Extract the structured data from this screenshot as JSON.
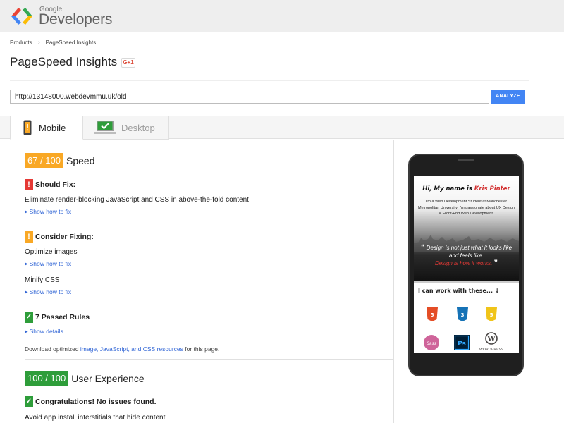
{
  "header": {
    "brand_small": "Google",
    "brand_big": "Developers"
  },
  "breadcrumb": {
    "items": [
      "Products",
      "PageSpeed Insights"
    ]
  },
  "page": {
    "title": "PageSpeed Insights",
    "gplus_label": "G+1"
  },
  "search": {
    "url_value": "http://13148000.webdevmmu.uk/old",
    "analyze_label": "ANALYZE"
  },
  "tabs": [
    {
      "label": "Mobile",
      "active": true
    },
    {
      "label": "Desktop",
      "active": false
    }
  ],
  "speed": {
    "score": "67 / 100",
    "label": "Speed",
    "should_fix_title": "Should Fix:",
    "should_fix_items": [
      {
        "text": "Eliminate render-blocking JavaScript and CSS in above-the-fold content",
        "link": "Show how to fix"
      }
    ],
    "consider_title": "Consider Fixing:",
    "consider_items": [
      {
        "text": "Optimize images",
        "link": "Show how to fix"
      },
      {
        "text": "Minify CSS",
        "link": "Show how to fix"
      }
    ],
    "passed_title": "7 Passed Rules",
    "passed_link": "Show details",
    "download_prefix": "Download optimized ",
    "download_link": "image, JavaScript, and CSS resources",
    "download_suffix": " for this page."
  },
  "ux": {
    "score": "100 / 100",
    "label": "User Experience",
    "congrats": "Congratulations! No issues found.",
    "item": "Avoid app install interstitials that hide content"
  },
  "indicators": {
    "should_fix": "!",
    "consider": "!",
    "passed": "✓",
    "congrats": "✓"
  },
  "preview": {
    "title_prefix": "Hi, My name is ",
    "title_name": "Kris Pinter",
    "subtitle": "I'm a Web Development Student at Manchester Metropolitan University. I'm passionate about UX Design & Front-End Web Development.",
    "quote_line1": "Design is not just what it looks like and feels like.",
    "quote_line2": "Design is how it works.",
    "quote_open": "“",
    "quote_close": "”",
    "work_heading": "I can work with these... ↓",
    "tech_labels": [
      "HTML",
      "CSS",
      "JS",
      "Sass",
      "Ps",
      "WordPress"
    ]
  },
  "colors": {
    "accent_blue": "#4285f4",
    "speed_badge": "#f9a825",
    "ux_badge": "#2e9d3a",
    "should_fix_red": "#e53935",
    "link_blue": "#3367d6"
  }
}
